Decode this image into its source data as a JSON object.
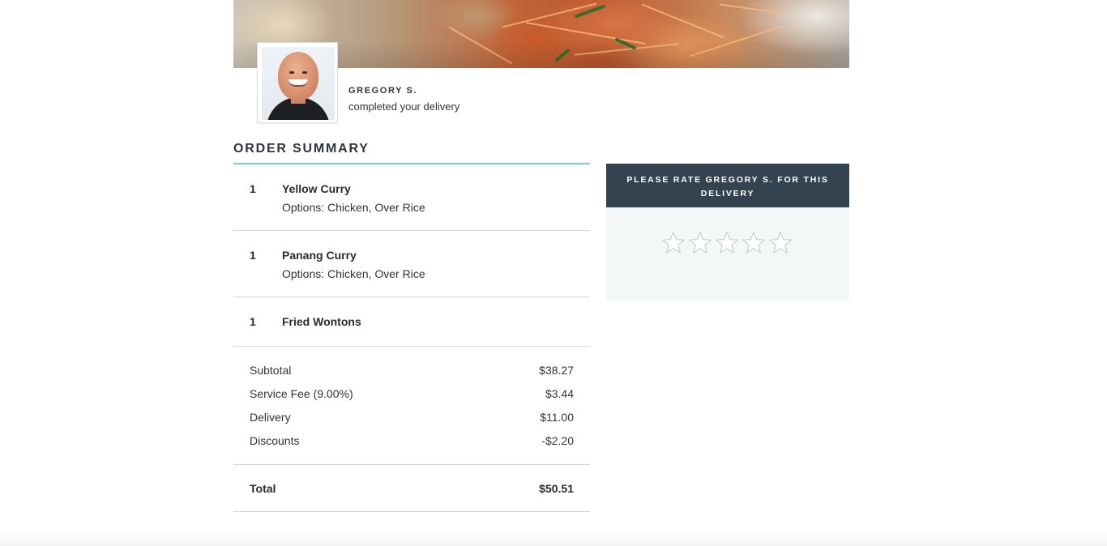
{
  "driver": {
    "name": "GREGORY S.",
    "status": "completed your delivery"
  },
  "order_summary": {
    "title": "ORDER SUMMARY",
    "items": [
      {
        "qty": "1",
        "name": "Yellow Curry",
        "options": "Options: Chicken, Over Rice"
      },
      {
        "qty": "1",
        "name": "Panang Curry",
        "options": "Options: Chicken, Over Rice"
      },
      {
        "qty": "1",
        "name": "Fried Wontons",
        "options": ""
      }
    ],
    "totals": [
      {
        "label": "Subtotal",
        "value": "$38.27"
      },
      {
        "label": "Service Fee (9.00%)",
        "value": "$3.44"
      },
      {
        "label": "Delivery",
        "value": "$11.00"
      },
      {
        "label": "Discounts",
        "value": "-$2.20"
      }
    ],
    "total": {
      "label": "Total",
      "value": "$50.51"
    }
  },
  "rating": {
    "prompt": "PLEASE RATE GREGORY S. FOR THIS DELIVERY",
    "max_stars": 5,
    "selected_stars": 0,
    "star_icon": "star-outline-icon"
  },
  "colors": {
    "accent_rule": "#6fd6cc",
    "rate_header_bg": "#334350",
    "rate_body_bg": "#f3f7f7"
  }
}
